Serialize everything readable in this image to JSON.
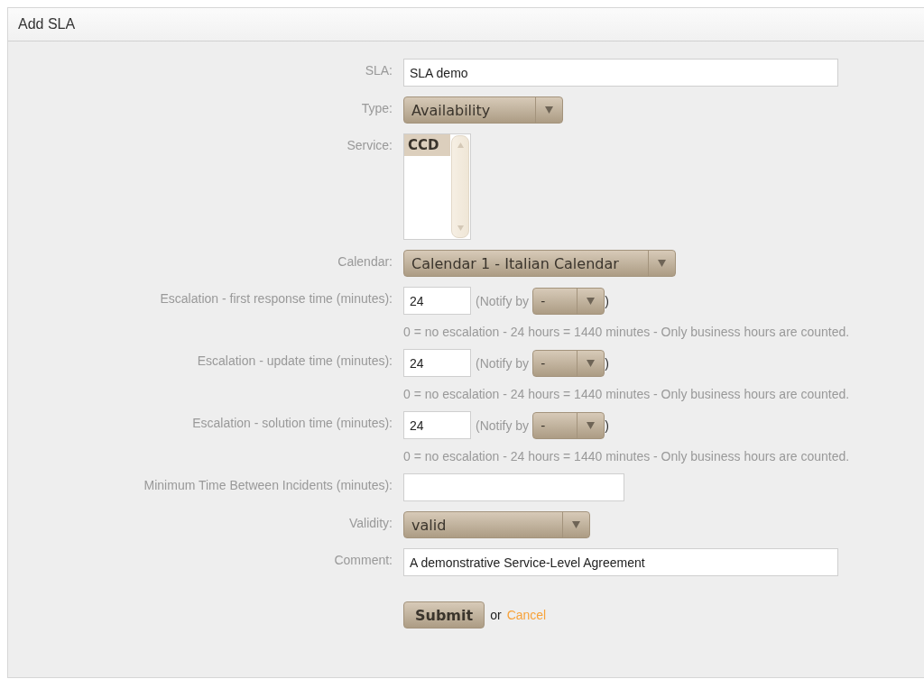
{
  "panel": {
    "title": "Add SLA"
  },
  "fields": [
    {
      "kind": "text",
      "label": "SLA:",
      "value": "SLA demo"
    },
    {
      "kind": "select",
      "label": "Type:",
      "value": "Availability"
    },
    {
      "kind": "listbox",
      "label": "Service:",
      "options": [
        {
          "label": "CCD",
          "selected": true
        }
      ]
    },
    {
      "kind": "select",
      "label": "Calendar:",
      "value": "Calendar 1 - Italian Calendar"
    },
    {
      "kind": "escalation",
      "label": "Escalation - first response time (minutes):",
      "value": "24",
      "notify_open": "(Notify by",
      "notify_value": "-",
      "notify_close": ")",
      "hint": "0 = no escalation - 24 hours = 1440 minutes - Only business hours are counted."
    },
    {
      "kind": "escalation",
      "label": "Escalation - update time (minutes):",
      "value": "24",
      "notify_open": "(Notify by",
      "notify_value": "-",
      "notify_close": ")",
      "hint": "0 = no escalation - 24 hours = 1440 minutes - Only business hours are counted."
    },
    {
      "kind": "escalation",
      "label": "Escalation - solution time (minutes):",
      "value": "24",
      "notify_open": "(Notify by",
      "notify_value": "-",
      "notify_close": ")",
      "hint": "0 = no escalation - 24 hours = 1440 minutes - Only business hours are counted."
    },
    {
      "kind": "text",
      "label": "Minimum Time Between Incidents (minutes):"
    },
    {
      "kind": "select",
      "label": "Validity:",
      "value": "valid"
    },
    {
      "kind": "text",
      "label": "Comment:",
      "value": "A demonstrative Service-Level Agreement"
    }
  ],
  "actions": {
    "submit": "Submit",
    "separator": "or",
    "cancel": "Cancel"
  }
}
